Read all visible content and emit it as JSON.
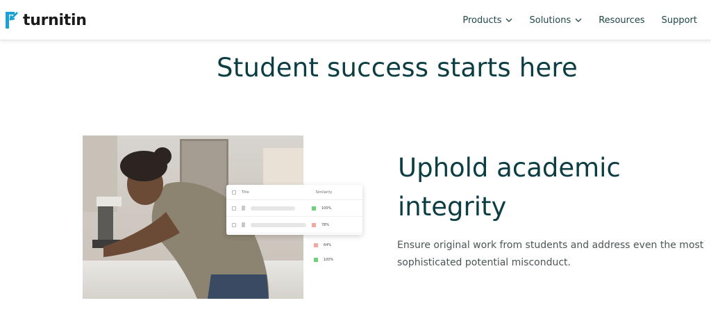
{
  "brand": {
    "name": "turnitin",
    "accent": "#1aa1d6"
  },
  "nav": {
    "items": [
      {
        "label": "Products",
        "has_dropdown": true
      },
      {
        "label": "Solutions",
        "has_dropdown": true
      },
      {
        "label": "Resources",
        "has_dropdown": false
      },
      {
        "label": "Support",
        "has_dropdown": false
      }
    ]
  },
  "hero": {
    "title": "Student success starts here"
  },
  "feature": {
    "heading": "Uphold academic integrity",
    "description": "Ensure original work from students and address even the most sophisticated potential misconduct."
  },
  "similarity_card": {
    "col_title": "Title",
    "col_similarity": "Similarity",
    "rows": [
      {
        "value": "100%",
        "color": "#6fd17a"
      },
      {
        "value": "78%",
        "color": "#f1a9a0"
      }
    ],
    "floating_rows": [
      {
        "value": "64%",
        "color": "#f1a9a0"
      },
      {
        "value": "100%",
        "color": "#6fd17a"
      }
    ]
  },
  "colors": {
    "heading": "#0b3d42",
    "body": "#4a5556",
    "nav": "#1f4548"
  }
}
